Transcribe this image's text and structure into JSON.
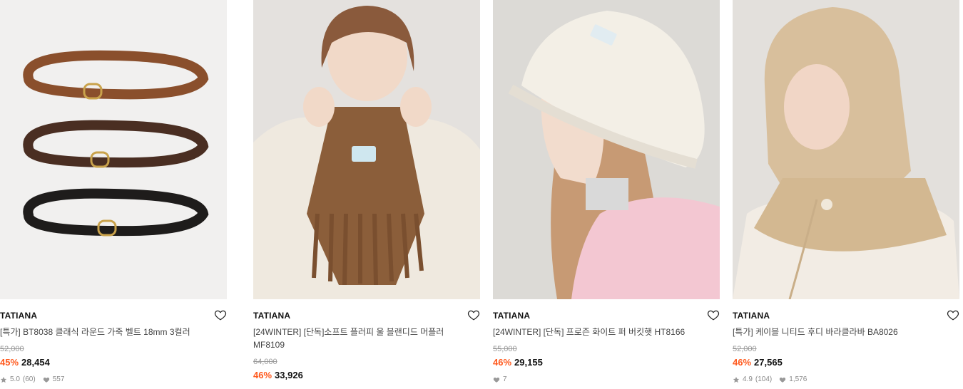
{
  "products": [
    {
      "brand": "TATIANA",
      "title": "[24WINTER] [단독]소프트 플러피 울 블랜디드 머플러 MF8109",
      "original_price": "64,000",
      "discount": "46%",
      "price": "33,926",
      "rating": "",
      "reviews": "",
      "likes": ""
    },
    {
      "brand": "TATIANA",
      "title": "[24WINTER] [단독] 프로즌 화이트 퍼 버킷햇 HT8166",
      "original_price": "55,000",
      "discount": "46%",
      "price": "29,155",
      "rating": "",
      "reviews": "",
      "likes": "7"
    },
    {
      "brand": "TATIANA",
      "title": "[특가] 케이블 니티드 후디 바라클라바 BA8026",
      "original_price": "52,000",
      "discount": "46%",
      "price": "27,565",
      "rating": "4.9",
      "reviews": "(104)",
      "likes": "1,576"
    },
    {
      "brand": "TATIANA",
      "title": "[특가] BT8038 클래식 라운드 가죽 벨트 18mm 3컬러",
      "original_price": "52,000",
      "discount": "45%",
      "price": "28,454",
      "rating": "5.0",
      "reviews": "(60)",
      "likes": "557"
    }
  ],
  "colors": {
    "discount": "#ff5a1e",
    "muted": "#888888"
  },
  "icons": {
    "wishlist": "heart-outline-icon",
    "rating": "star-icon",
    "likes": "heart-filled-icon"
  }
}
